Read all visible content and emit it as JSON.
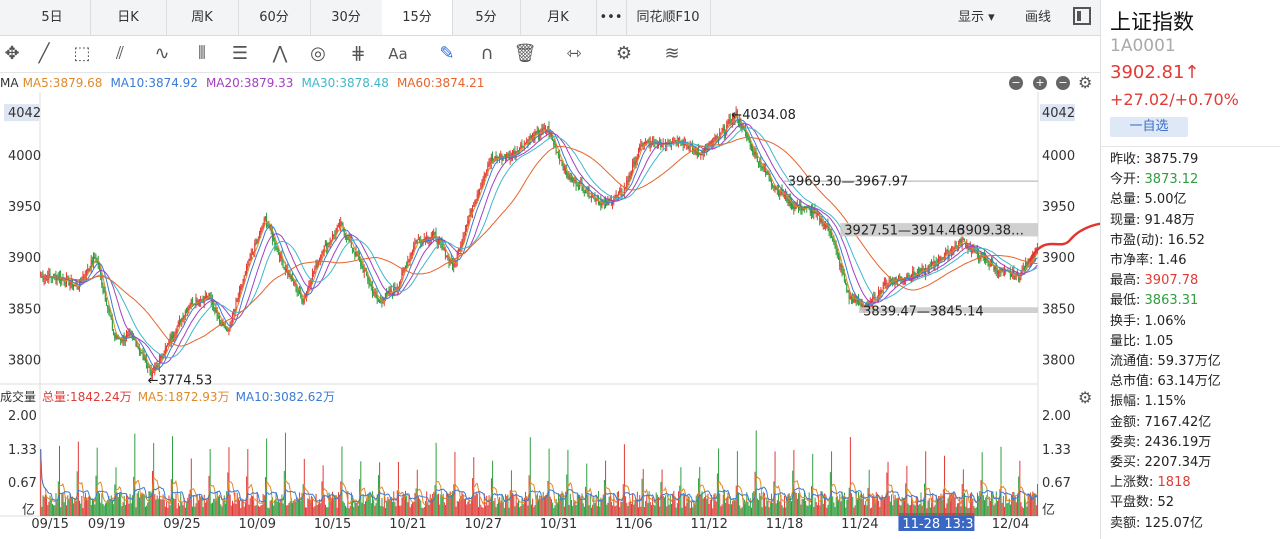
{
  "tabs": {
    "items": [
      "5日",
      "日K",
      "周K",
      "60分",
      "30分",
      "15分",
      "5分",
      "月K",
      "•••",
      "同花顺F10"
    ],
    "active": "15分",
    "display_label": "显示 ▾",
    "draw_label": "画线"
  },
  "ma_legend": {
    "label": "MA",
    "items": [
      {
        "text": "MA5:3879.68",
        "color": "#e08a2a"
      },
      {
        "text": "MA10:3874.92",
        "color": "#3a7bd5"
      },
      {
        "text": "MA20:3879.33",
        "color": "#a23fc0"
      },
      {
        "text": "MA30:3878.48",
        "color": "#3fb8c9"
      },
      {
        "text": "MA60:3874.21",
        "color": "#e8632a"
      }
    ]
  },
  "volume_legend": {
    "label": "成交量",
    "items": [
      {
        "text": "总量:1842.24万",
        "color": "#e03b36"
      },
      {
        "text": "MA5:1872.93万",
        "color": "#e08a2a"
      },
      {
        "text": "MA10:3082.62万",
        "color": "#3a7bd5"
      }
    ]
  },
  "chart_data": [
    {
      "type": "candlestick",
      "title": "上证指数 15分",
      "ylim": [
        3770,
        4048
      ],
      "y_ticks": [
        4042,
        4000,
        3950,
        3900,
        3850,
        3800
      ],
      "x_ticks": [
        "09/15",
        "09/19",
        "09/25",
        "10/09",
        "10/15",
        "10/21",
        "10/27",
        "10/31",
        "11/06",
        "11/12",
        "11/18",
        "11/24",
        "11-28 13:30",
        "12/04"
      ],
      "close_anchors": [
        {
          "date": "09/15",
          "value": 3875
        },
        {
          "date": "09/17",
          "value": 3865
        },
        {
          "date": "09/18",
          "value": 3895
        },
        {
          "date": "09/19",
          "value": 3815
        },
        {
          "date": "09/22",
          "value": 3815
        },
        {
          "date": "09/23",
          "value": 3779
        },
        {
          "date": "09/24",
          "value": 3815
        },
        {
          "date": "09/25",
          "value": 3850
        },
        {
          "date": "09/26",
          "value": 3855
        },
        {
          "date": "09/29",
          "value": 3820
        },
        {
          "date": "09/30",
          "value": 3882
        },
        {
          "date": "10/09",
          "value": 3932
        },
        {
          "date": "10/10",
          "value": 3885
        },
        {
          "date": "10/13",
          "value": 3852
        },
        {
          "date": "10/14",
          "value": 3900
        },
        {
          "date": "10/15",
          "value": 3925
        },
        {
          "date": "10/16",
          "value": 3890
        },
        {
          "date": "10/17",
          "value": 3850
        },
        {
          "date": "10/20",
          "value": 3865
        },
        {
          "date": "10/21",
          "value": 3910
        },
        {
          "date": "10/22",
          "value": 3915
        },
        {
          "date": "10/23",
          "value": 3885
        },
        {
          "date": "10/24",
          "value": 3945
        },
        {
          "date": "10/27",
          "value": 3990
        },
        {
          "date": "10/28",
          "value": 3993
        },
        {
          "date": "10/29",
          "value": 4010
        },
        {
          "date": "10/30",
          "value": 4020
        },
        {
          "date": "10/31",
          "value": 3975
        },
        {
          "date": "11/03",
          "value": 3960
        },
        {
          "date": "11/04",
          "value": 3945
        },
        {
          "date": "11/05",
          "value": 3958
        },
        {
          "date": "11/06",
          "value": 4005
        },
        {
          "date": "11/07",
          "value": 4005
        },
        {
          "date": "11/10",
          "value": 4010
        },
        {
          "date": "11/11",
          "value": 3995
        },
        {
          "date": "11/12",
          "value": 4010
        },
        {
          "date": "11/13",
          "value": 4034
        },
        {
          "date": "11/14",
          "value": 3995
        },
        {
          "date": "11/17",
          "value": 3965
        },
        {
          "date": "11/18",
          "value": 3945
        },
        {
          "date": "11/19",
          "value": 3940
        },
        {
          "date": "11/20",
          "value": 3920
        },
        {
          "date": "11/21",
          "value": 3855
        },
        {
          "date": "11/24",
          "value": 3845
        },
        {
          "date": "11/25",
          "value": 3870
        },
        {
          "date": "11/26",
          "value": 3875
        },
        {
          "date": "11/27",
          "value": 3880
        },
        {
          "date": "11/28",
          "value": 3895
        },
        {
          "date": "12/01",
          "value": 3910
        },
        {
          "date": "12/02",
          "value": 3895
        },
        {
          "date": "12/03",
          "value": 3880
        },
        {
          "date": "12/04",
          "value": 3875
        },
        {
          "date": "12/05",
          "value": 3903
        }
      ],
      "annotations": [
        {
          "text": "←4034.08",
          "date": "11/13",
          "value": 4034.08
        },
        {
          "text": "←3774.53",
          "date": "09/23",
          "value": 3774.53
        },
        {
          "text": "3969.30—3967.97",
          "date": "11/18",
          "value": 3969
        },
        {
          "text": "3927.51—3914.46",
          "date": "11/21",
          "value": 3921
        },
        {
          "text": "3909.38…",
          "date": "12/01",
          "value": 3921
        },
        {
          "text": "3839.47—3845.14",
          "date": "11/24",
          "value": 3842
        }
      ],
      "bands": [
        {
          "low": 3914.46,
          "high": 3927.51,
          "color": "#c8c8c8",
          "from": "11/21"
        },
        {
          "low": 3839.47,
          "high": 3845.14,
          "color": "#c8c8c8",
          "from": "11/24"
        },
        {
          "low": 3967.97,
          "high": 3969.3,
          "color": "#bdbdbd",
          "from": "11/18"
        }
      ],
      "ma_periods": [
        5,
        10,
        20,
        30,
        60
      ],
      "up_color": "#e03b36",
      "down_color": "#2f9e3f"
    },
    {
      "type": "bar",
      "title": "成交量",
      "unit": "亿",
      "y_ticks": [
        2.0,
        1.33,
        0.67
      ],
      "ylim": [
        0,
        2.1
      ],
      "series": [
        {
          "name": "总量"
        },
        {
          "name": "MA5"
        },
        {
          "name": "MA10"
        }
      ]
    }
  ],
  "side_panel": {
    "title": "上证指数",
    "code": "1A0001",
    "price": "3902.81↑",
    "change": "+27.02/+0.70%",
    "watch_button": "一自选",
    "stats": [
      {
        "label": "昨收:",
        "value": "3875.79",
        "tone": ""
      },
      {
        "label": "今开:",
        "value": "3873.12",
        "tone": "dn"
      },
      {
        "label": "总量:",
        "value": "5.00亿",
        "tone": ""
      },
      {
        "label": "现量:",
        "value": "91.48万",
        "tone": ""
      },
      {
        "label": "市盈(动):",
        "value": "16.52",
        "tone": ""
      },
      {
        "label": "市净率:",
        "value": "1.46",
        "tone": ""
      },
      {
        "label": "最高:",
        "value": "3907.78",
        "tone": "up"
      },
      {
        "label": "最低:",
        "value": "3863.31",
        "tone": "dn"
      },
      {
        "label": "换手:",
        "value": "1.06%",
        "tone": ""
      },
      {
        "label": "量比:",
        "value": "1.05",
        "tone": ""
      },
      {
        "label": "流通值:",
        "value": "59.37万亿",
        "tone": ""
      },
      {
        "label": "总市值:",
        "value": "63.14万亿",
        "tone": ""
      },
      {
        "label": "振幅:",
        "value": "1.15%",
        "tone": ""
      },
      {
        "label": "金额:",
        "value": "7167.42亿",
        "tone": ""
      },
      {
        "label": "委卖:",
        "value": "2436.19万",
        "tone": ""
      },
      {
        "label": "委买:",
        "value": "2207.34万",
        "tone": ""
      },
      {
        "label": "上涨数:",
        "value": "1818",
        "tone": "up"
      },
      {
        "label": "平盘数:",
        "value": "52",
        "tone": ""
      },
      {
        "label": "卖额:",
        "value": "125.07亿",
        "tone": ""
      }
    ]
  }
}
